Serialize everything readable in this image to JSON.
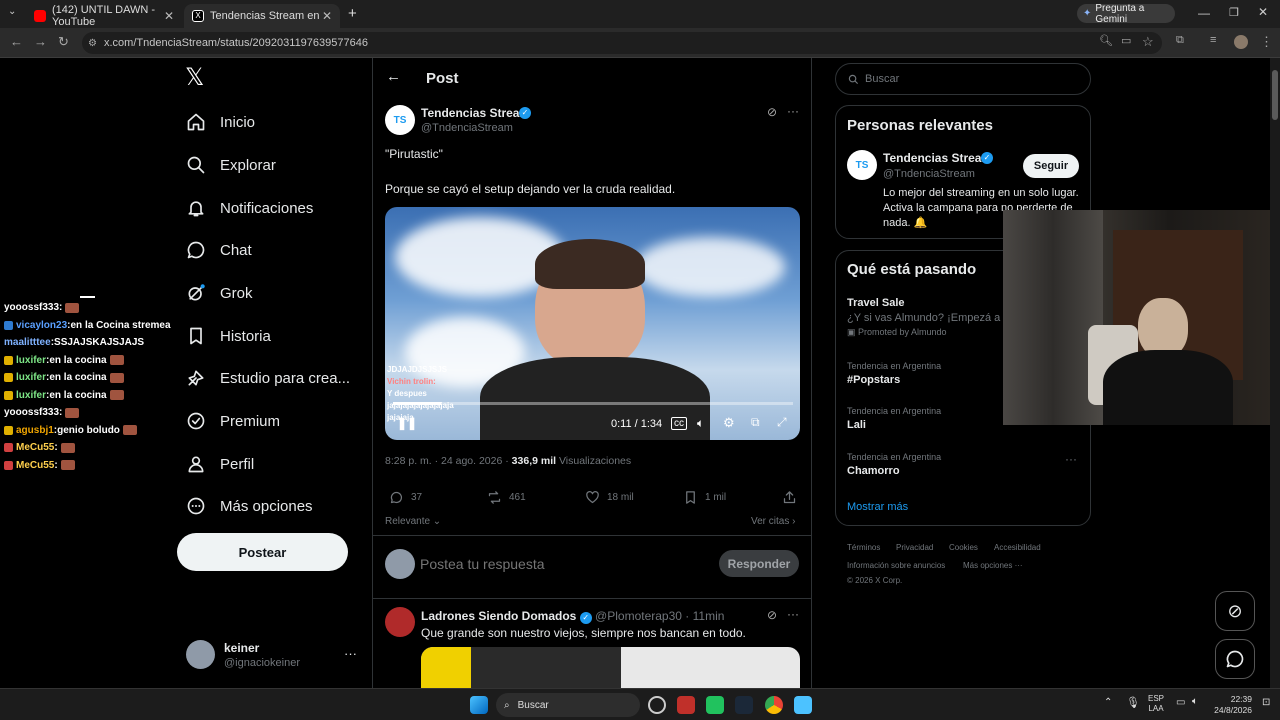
{
  "browser": {
    "tabs": [
      {
        "label": "(142) UNTIL DAWN - YouTube",
        "fav_color": "#ff0000"
      },
      {
        "label": "Tendencias Stream en X: \"\"",
        "fav_color": "#ffffff"
      }
    ],
    "new_tab": "+",
    "url": "x.com/TndenciaStream/status/2092031197639577646",
    "gemini_label": "Pregunta a Gemini"
  },
  "sidebar": {
    "logo": "𝕏",
    "items": [
      {
        "label": "Inicio",
        "icon": "home-icon"
      },
      {
        "label": "Explorar",
        "icon": "search-icon"
      },
      {
        "label": "Notificaciones",
        "icon": "bell-icon"
      },
      {
        "label": "Chat",
        "icon": "chat-icon"
      },
      {
        "label": "Grok",
        "icon": "grok-icon"
      },
      {
        "label": "Historia",
        "icon": "bookmark-icon"
      },
      {
        "label": "Estudio para crea...",
        "icon": "studio-icon"
      },
      {
        "label": "Premium",
        "icon": "verified-icon"
      },
      {
        "label": "Perfil",
        "icon": "person-icon"
      },
      {
        "label": "Más opciones",
        "icon": "more-circle-icon"
      }
    ],
    "post_button": "Postear",
    "account": {
      "name": "keiner",
      "handle": "@ignaciokeiner"
    }
  },
  "stream_chat": [
    {
      "user": "yooossf333",
      "msg": "",
      "color": "#ffffff",
      "badge": "",
      "emote": true
    },
    {
      "user": "vicaylon23",
      "msg": "en la Cocina stremea",
      "color": "#5aa0ff",
      "badge": "#2e7bd1",
      "emote": false
    },
    {
      "user": "maalitttee",
      "msg": "SSJAJSKAJSJAJS",
      "color": "#7fb2ff",
      "badge": "",
      "emote": false
    },
    {
      "user": "luxifer",
      "msg": "en la cocina",
      "color": "#7ee787",
      "badge": "#e0b000",
      "emote": true
    },
    {
      "user": "luxifer",
      "msg": "en la cocina",
      "color": "#7ee787",
      "badge": "#e0b000",
      "emote": true
    },
    {
      "user": "luxifer",
      "msg": "en la cocina",
      "color": "#7ee787",
      "badge": "#e0b000",
      "emote": true
    },
    {
      "user": "yooossf333",
      "msg": "",
      "color": "#ffffff",
      "badge": "",
      "emote": true
    },
    {
      "user": "agusbj1",
      "msg": "genio boludo",
      "color": "#f0a500",
      "badge": "#e0b000",
      "emote": true
    },
    {
      "user": "MeCu55",
      "msg": "",
      "color": "#ffd04d",
      "badge": "#d04040",
      "emote": true
    },
    {
      "user": "MeCu55",
      "msg": "",
      "color": "#ffd04d",
      "badge": "#d04040",
      "emote": true
    }
  ],
  "main": {
    "header": "Post",
    "post": {
      "author": "Tendencias Stream",
      "handle": "@TndenciaStream",
      "line1": "\"Pirutastic\"",
      "line2": "Porque se cayó el setup dejando ver la cruda realidad.",
      "video_time": "0:11 / 1:34",
      "video_progress": 0.12,
      "overlay_chat": [
        "JDJAJDJSJSJS",
        "Vichin trolin:",
        "Y despues",
        "jajajajajajajajajaja",
        "jajajaja"
      ],
      "timestamp": "8:28 p. m. · 24 ago. 2026 ·",
      "views_count": "336,9 mil",
      "views_label": "Visualizaciones",
      "stats": {
        "replies": "37",
        "reposts": "461",
        "likes": "18 mil",
        "bookmarks": "1 mil"
      },
      "sort_label": "Relevante",
      "quotes_label": "Ver citas"
    },
    "reply_placeholder": "Postea tu respuesta",
    "reply_button": "Responder",
    "reply": {
      "author": "Ladrones Siendo Domados",
      "handle": "@Plomoterap30",
      "time": "· 11min",
      "text": "Que grande son nuestro viejos, siempre nos bancan en todo."
    }
  },
  "right": {
    "search_placeholder": "Buscar",
    "relevant_title": "Personas relevantes",
    "relevant": {
      "name": "Tendencias Stream",
      "handle": "@TndenciaStream",
      "bio": "Lo mejor del streaming en un solo lugar. Activa la campana para no perderte de nada. 🔔",
      "follow": "Seguir"
    },
    "happening_title": "Qué está pasando",
    "promo": {
      "title": "Travel Sale",
      "text": "¿Y si vas Almundo? ¡Empezá a vi",
      "promoted": "Promoted by Almundo"
    },
    "trends": [
      {
        "context": "Tendencia en Argentina",
        "title": "#Popstars"
      },
      {
        "context": "Tendencia en Argentina",
        "title": "Lali"
      },
      {
        "context": "Tendencia en Argentina",
        "title": "Chamorro"
      }
    ],
    "show_more": "Mostrar más",
    "footer": [
      "Términos",
      "Privacidad",
      "Cookies",
      "Accesibilidad",
      "Información sobre anuncios",
      "Más opciones ···",
      "© 2026 X Corp."
    ]
  },
  "taskbar": {
    "search": "Buscar",
    "lang": "ESP",
    "lang2": "LAA",
    "time": "22:39",
    "date": "24/8/2026"
  }
}
